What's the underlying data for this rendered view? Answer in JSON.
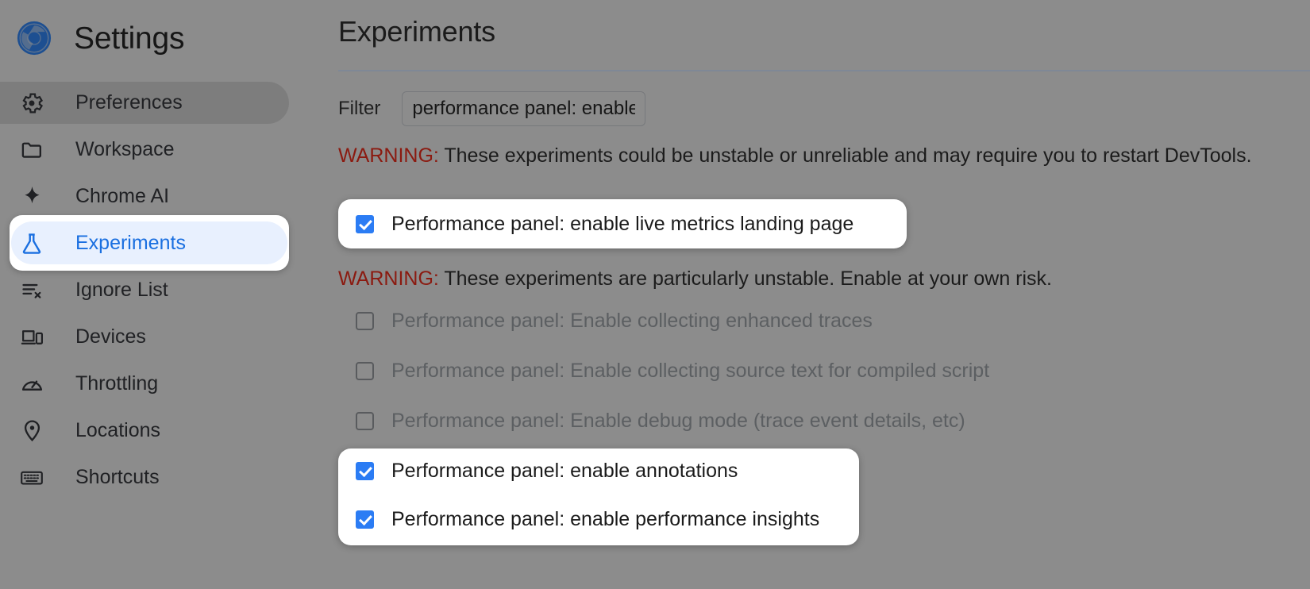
{
  "app": {
    "title": "Settings",
    "logo_icon": "chrome-logo-icon"
  },
  "sidebar": {
    "items": [
      {
        "label": "Preferences",
        "icon": "gear-icon",
        "state": "hover"
      },
      {
        "label": "Workspace",
        "icon": "folder-icon",
        "state": "normal"
      },
      {
        "label": "Chrome AI",
        "icon": "sparkle-icon",
        "state": "normal"
      },
      {
        "label": "Experiments",
        "icon": "flask-icon",
        "state": "selected"
      },
      {
        "label": "Ignore List",
        "icon": "list-x-icon",
        "state": "normal"
      },
      {
        "label": "Devices",
        "icon": "devices-icon",
        "state": "normal"
      },
      {
        "label": "Throttling",
        "icon": "gauge-icon",
        "state": "normal"
      },
      {
        "label": "Locations",
        "icon": "map-pin-icon",
        "state": "normal"
      },
      {
        "label": "Shortcuts",
        "icon": "keyboard-icon",
        "state": "normal"
      }
    ]
  },
  "main": {
    "page_title": "Experiments",
    "filter": {
      "label": "Filter",
      "value": "performance panel: enable",
      "placeholder": ""
    },
    "warnings": [
      {
        "prefix": "WARNING:",
        "text": " These experiments could be unstable or unreliable and may require you to restart DevTools."
      },
      {
        "prefix": "WARNING:",
        "text": " These experiments are particularly unstable. Enable at your own risk."
      }
    ],
    "experiments_stable": [
      {
        "label": "Performance panel: enable live metrics landing page",
        "checked": true,
        "disabled": false
      }
    ],
    "experiments_unstable": [
      {
        "label": "Performance panel: Enable collecting enhanced traces",
        "checked": false,
        "disabled": true
      },
      {
        "label": "Performance panel: Enable collecting source text for compiled script",
        "checked": false,
        "disabled": true
      },
      {
        "label": "Performance panel: Enable debug mode (trace event details, etc)",
        "checked": false,
        "disabled": true
      },
      {
        "label": "Performance panel: enable annotations",
        "checked": true,
        "disabled": false
      },
      {
        "label": "Performance panel: enable performance insights",
        "checked": true,
        "disabled": false
      }
    ]
  },
  "colors": {
    "page_background": "#8c8c8c",
    "accent_blue": "#1a6fe0",
    "checkbox_blue": "#2b7cf4",
    "warning_red": "#8b1a10",
    "selected_pill": "#e8f0fe",
    "card_white": "#ffffff",
    "divider": "#7f8896"
  }
}
